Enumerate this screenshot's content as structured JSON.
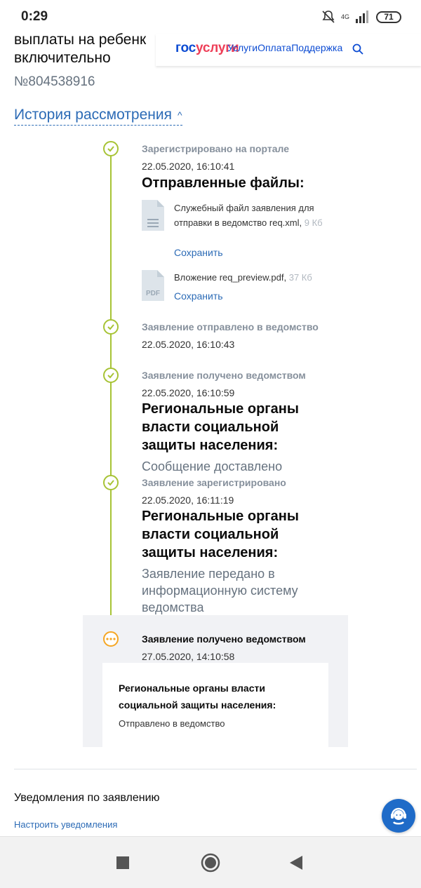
{
  "status_bar": {
    "time": "0:29",
    "network": "4G",
    "battery": "71"
  },
  "page": {
    "title": "выплаты на ребенк\nвключительно",
    "number": "№804538916"
  },
  "header": {
    "logo_part1": "гос",
    "logo_part2": "услуги",
    "nav": [
      "Услуги",
      "Оплата",
      "Поддержка"
    ]
  },
  "history": {
    "title": "История рассмотрения",
    "events": [
      {
        "title": "Зарегистрировано на портале",
        "date": "22.05.2020, 16:10:41",
        "heading": "Отправленные файлы:",
        "files": [
          {
            "name": "Служебный файл заявления для отправки в ведомство req.xml,",
            "size": "9 Кб",
            "save": "Сохранить"
          },
          {
            "name": "Вложение req_preview.pdf,",
            "size": "37 Кб",
            "save": "Сохранить",
            "badge": "PDF"
          }
        ]
      },
      {
        "title": "Заявление отправлено в ведомство",
        "date": "22.05.2020, 16:10:43"
      },
      {
        "title": "Заявление получено ведомством",
        "date": "22.05.2020, 16:10:59",
        "heading": "Региональные органы власти социальной защиты населения:",
        "text": "Сообщение доставлено"
      },
      {
        "title": "Заявление зарегистрировано",
        "date": "22.05.2020, 16:11:19",
        "heading": "Региональные органы власти социальной защиты населения:",
        "text": "Заявление передано в информационную систему ведомства"
      },
      {
        "title": "Заявление получено ведомством",
        "date": "27.05.2020, 14:10:58",
        "heading": "Региональные органы власти социальной защиты населения:",
        "text": "Отправлено в ведомство"
      }
    ]
  },
  "notifications": {
    "title": "Уведомления по заявлению",
    "link": "Настроить уведомления"
  },
  "icons": {
    "support": "support-agent-icon",
    "search": "search-icon",
    "check": "check-icon",
    "pending": "dots-icon"
  },
  "colors": {
    "accent": "#2c6bb6",
    "timeline": "#a7c335",
    "pending": "#f5a623",
    "brand_blue": "#0d4cd3",
    "brand_red": "#ee3f58"
  }
}
